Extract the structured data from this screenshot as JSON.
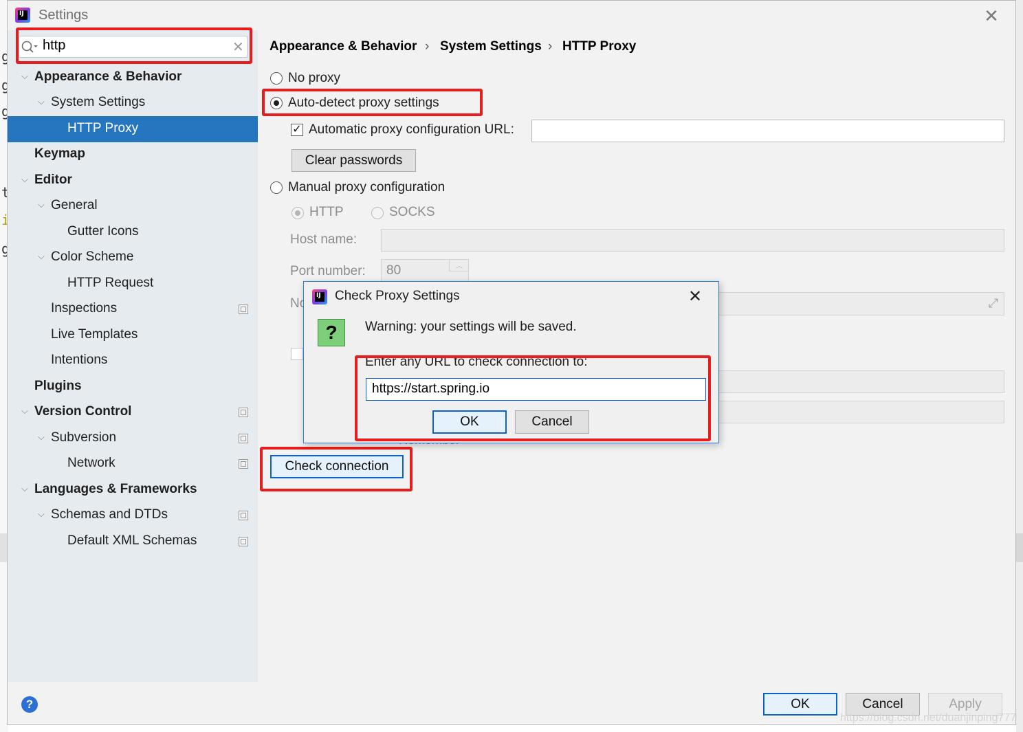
{
  "window": {
    "title": "Settings"
  },
  "search": {
    "value": "http"
  },
  "sidebar": {
    "items": [
      {
        "label": "Appearance & Behavior"
      },
      {
        "label": "System Settings"
      },
      {
        "label": "HTTP Proxy"
      },
      {
        "label": "Keymap"
      },
      {
        "label": "Editor"
      },
      {
        "label": "General"
      },
      {
        "label": "Gutter Icons"
      },
      {
        "label": "Color Scheme"
      },
      {
        "label": "HTTP Request"
      },
      {
        "label": "Inspections"
      },
      {
        "label": "Live Templates"
      },
      {
        "label": "Intentions"
      },
      {
        "label": "Plugins"
      },
      {
        "label": "Version Control"
      },
      {
        "label": "Subversion"
      },
      {
        "label": "Network"
      },
      {
        "label": "Languages & Frameworks"
      },
      {
        "label": "Schemas and DTDs"
      },
      {
        "label": "Default XML Schemas"
      }
    ]
  },
  "breadcrumb": [
    "Appearance & Behavior",
    "System Settings",
    "HTTP Proxy"
  ],
  "proxy": {
    "no_proxy": "No proxy",
    "auto_detect": "Auto-detect proxy settings",
    "auto_url_label": "Automatic proxy configuration URL:",
    "auto_url_value": "",
    "clear_passwords": "Clear passwords",
    "manual": "Manual proxy configuration",
    "http": "HTTP",
    "socks": "SOCKS",
    "host_label": "Host name:",
    "port_label": "Port number:",
    "port_value": "80",
    "no_proxy_label_partial": "No",
    "remember_partial": "Remember",
    "check_connection": "Check connection",
    "selected_mode": "auto_detect"
  },
  "popup": {
    "title": "Check Proxy Settings",
    "warning": "Warning: your settings will be saved.",
    "prompt": "Enter any URL to check connection to:",
    "url_value": "https://start.spring.io",
    "ok": "OK",
    "cancel": "Cancel"
  },
  "footer": {
    "ok": "OK",
    "cancel": "Cancel",
    "apply": "Apply"
  },
  "watermark": "https://blog.csdn.net/duanjinping777",
  "colors": {
    "selection": "#2675bf",
    "highlight_red": "#e81c1c",
    "focus_blue": "#0a64c8"
  }
}
